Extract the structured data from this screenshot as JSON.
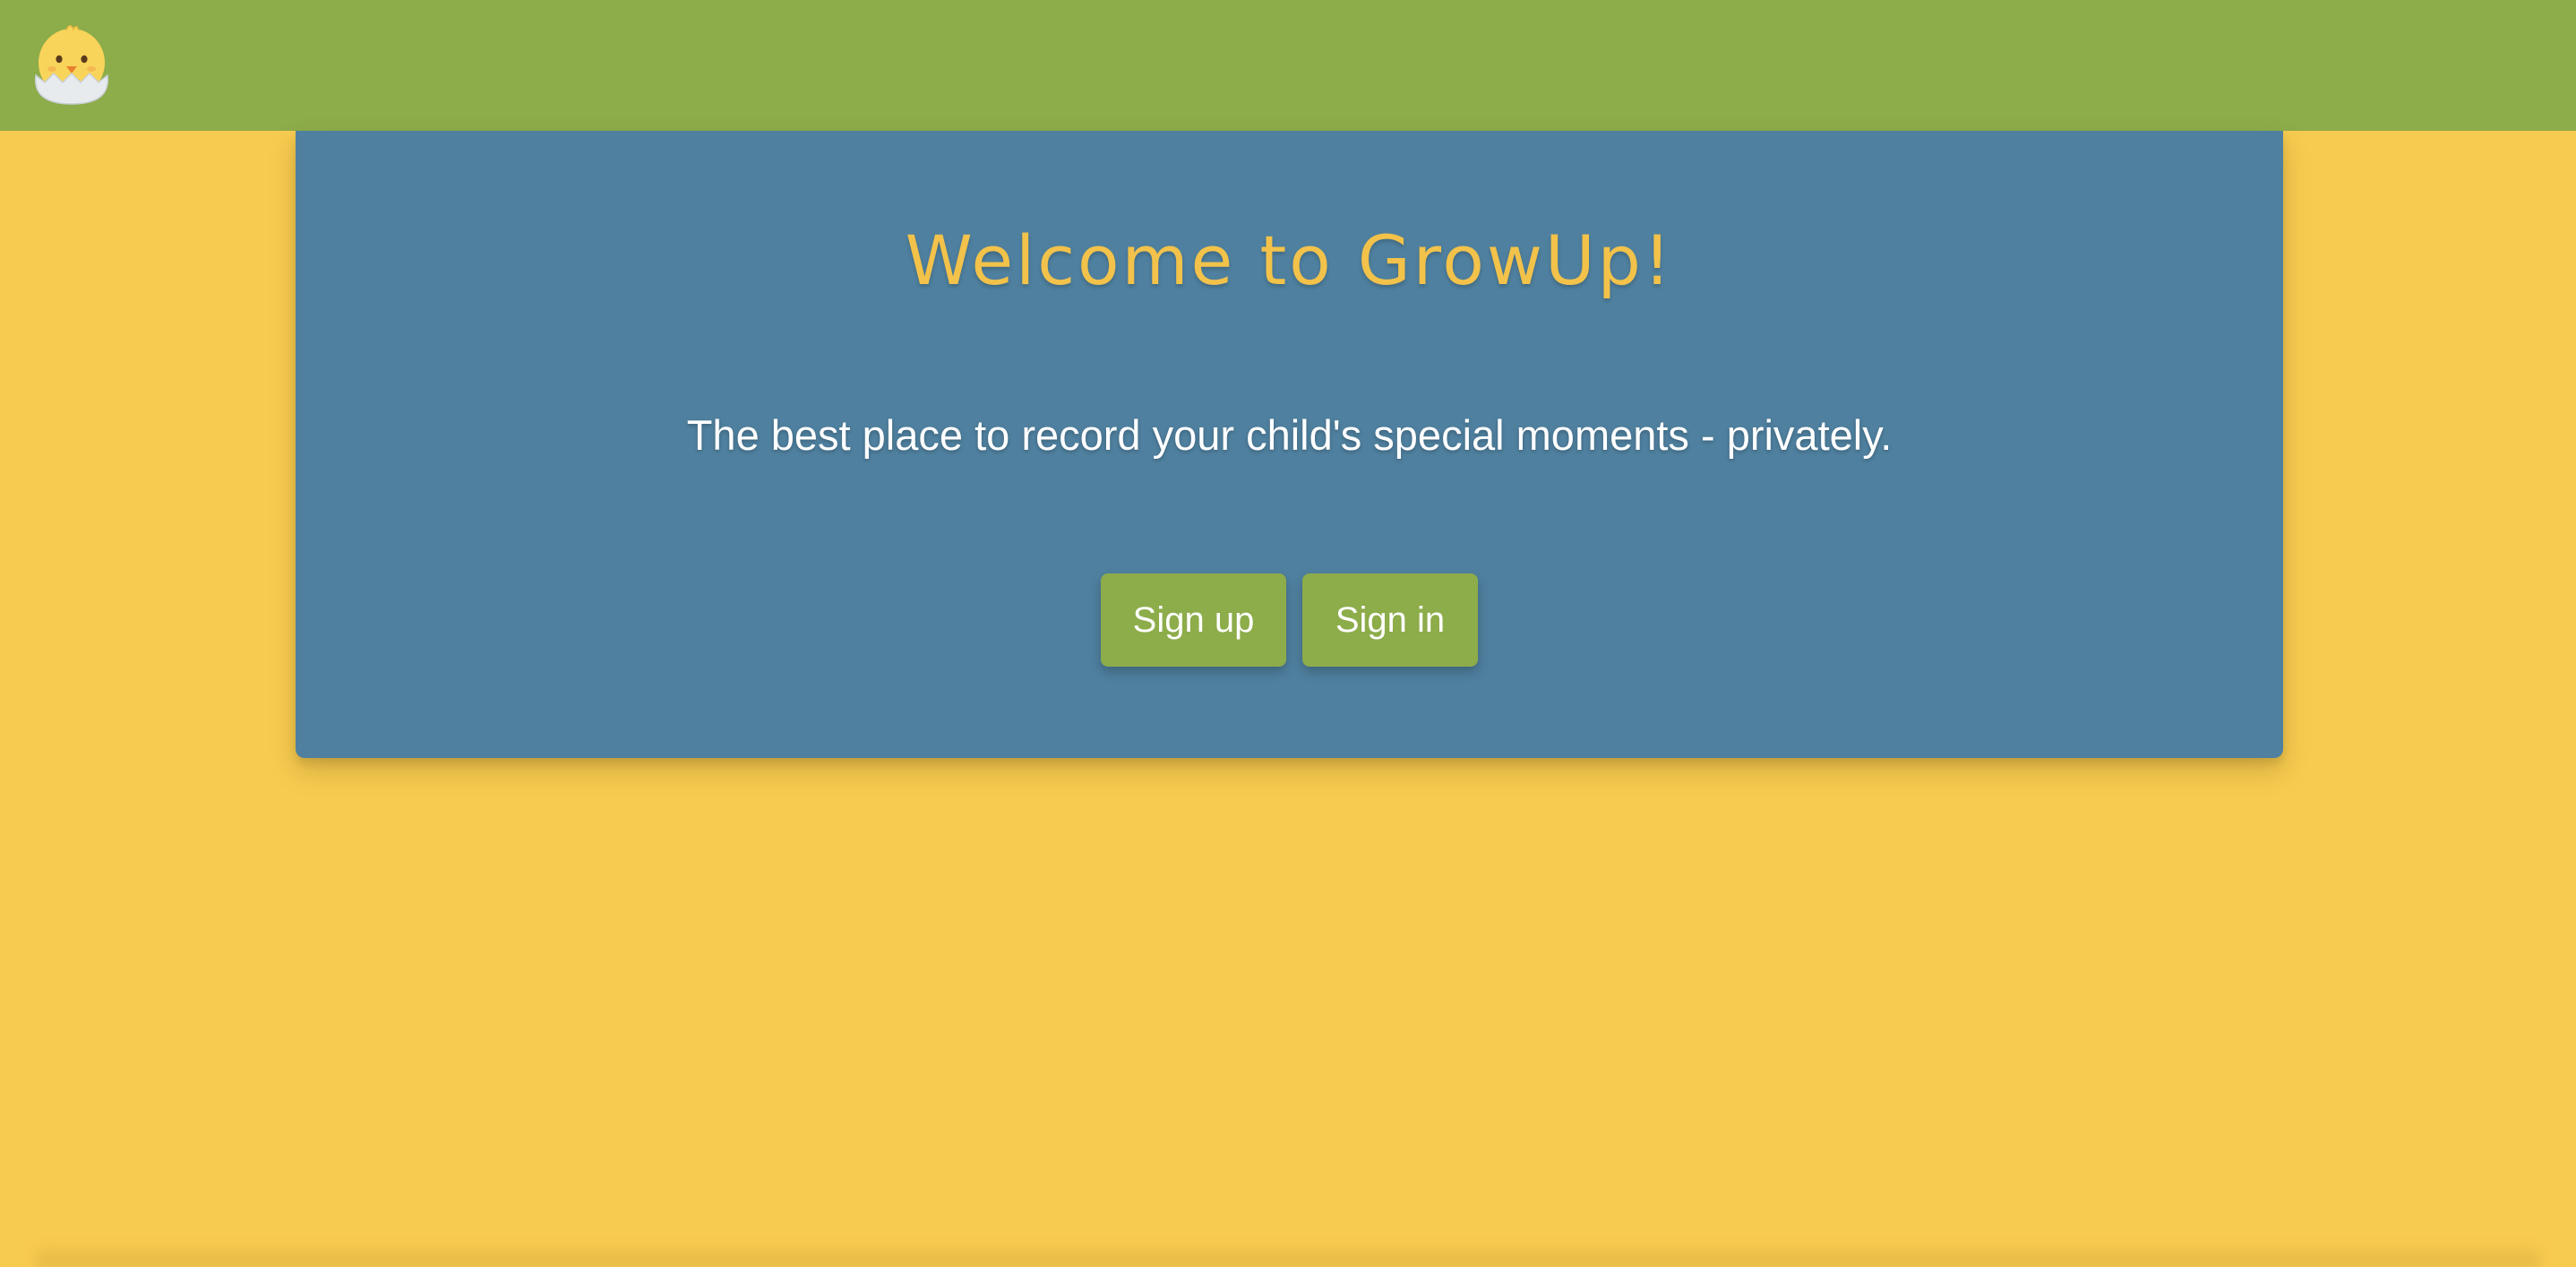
{
  "header": {
    "logo_icon": "hatching-chick-icon",
    "background": "#8DAC4A"
  },
  "page": {
    "background": "#F7CB50"
  },
  "hero": {
    "title": "Welcome to GrowUp!",
    "subtitle": "The best place to record your child's special moments - privately.",
    "background": "#4F809F",
    "title_color": "#F2C24A"
  },
  "actions": {
    "sign_up_label": "Sign up",
    "sign_in_label": "Sign in",
    "button_color": "#8DAC4A"
  }
}
